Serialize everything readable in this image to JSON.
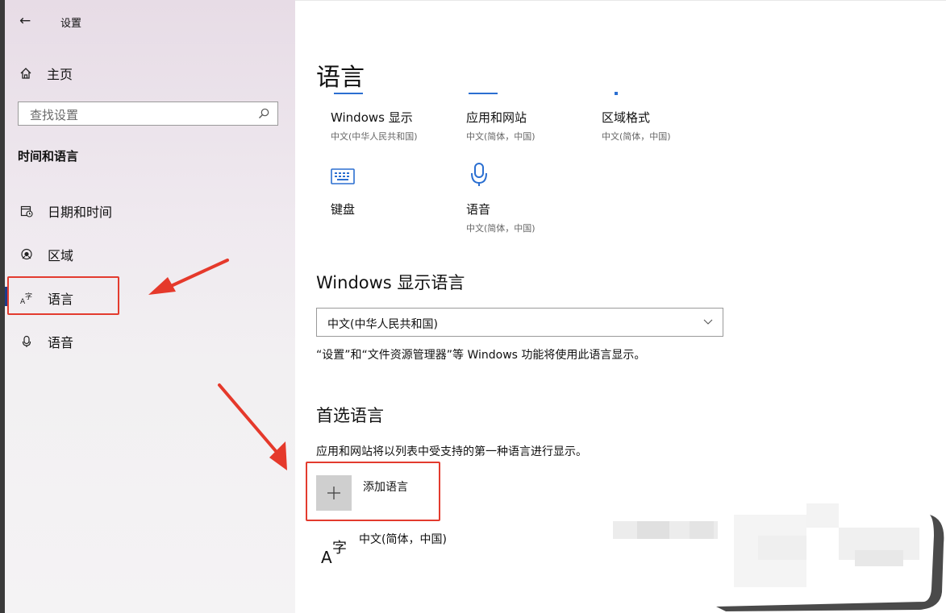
{
  "window": {
    "title": "设置",
    "back_icon": "back-arrow-icon"
  },
  "sidebar": {
    "home_label": "主页",
    "search_placeholder": "查找设置",
    "section_title": "时间和语言",
    "items": [
      {
        "label": "日期和时间",
        "icon": "calendar-clock-icon"
      },
      {
        "label": "区域",
        "icon": "globe-region-icon"
      },
      {
        "label": "语言",
        "icon": "language-icon",
        "active": true
      },
      {
        "label": "语音",
        "icon": "microphone-icon"
      }
    ]
  },
  "main": {
    "title": "语言",
    "tiles": [
      {
        "name": "Windows 显示",
        "sub": "中文(中华人民共和国)"
      },
      {
        "name": "应用和网站",
        "sub": "中文(简体，中国)"
      },
      {
        "name": "区域格式",
        "sub": "中文(简体，中国)"
      },
      {
        "name": "键盘",
        "sub": "",
        "icon": "keyboard-icon"
      },
      {
        "name": "语音",
        "sub": "中文(简体，中国)",
        "icon": "microphone-icon"
      }
    ],
    "display_language": {
      "heading": "Windows 显示语言",
      "selected": "中文(中华人民共和国)",
      "description": "“设置”和“文件资源管理器”等 Windows 功能将使用此语言显示。"
    },
    "preferred": {
      "heading": "首选语言",
      "description": "应用和网站将以列表中受支持的第一种语言进行显示。",
      "add_label": "添加语言",
      "languages": [
        {
          "name": "中文(简体，中国)",
          "icon": "language-az-icon"
        }
      ]
    }
  },
  "annotation_colors": {
    "highlight": "#e33b2e",
    "accent": "#2b6fd1"
  }
}
